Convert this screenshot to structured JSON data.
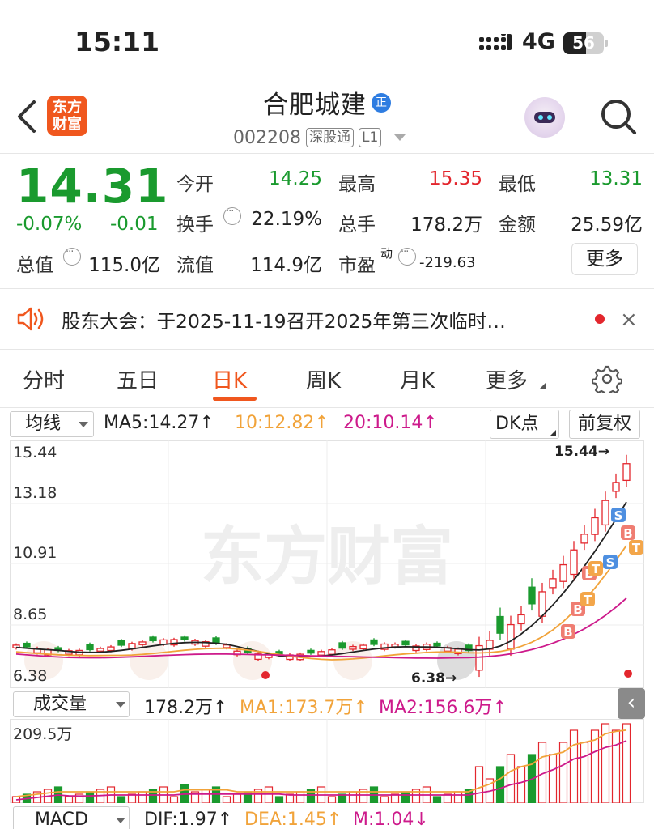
{
  "status_bar": {
    "time": "15:11",
    "network": "4G",
    "battery": "56",
    "battery_level": 0.56
  },
  "header": {
    "stock_name": "合肥城建",
    "badge": "正",
    "stock_code": "002208",
    "tag_connect": "深股通",
    "tag_level": "L1",
    "logo_line1": "东方",
    "logo_line2": "财富"
  },
  "quote": {
    "price": "14.31",
    "change_pct": "-0.07%",
    "change_amt": "-0.01",
    "open_label": "今开",
    "open_value": "14.25",
    "high_label": "最高",
    "high_value": "15.35",
    "low_label": "最低",
    "low_value": "13.31",
    "turnover_label": "换手",
    "turnover_value": "22.19%",
    "volume_label": "总手",
    "volume_value": "178.2万",
    "amount_label": "金额",
    "amount_value": "25.59亿",
    "mktcap_label": "总值",
    "mktcap_value": "115.0亿",
    "float_label": "流值",
    "float_value": "114.9亿",
    "pe_label": "市盈",
    "pe_sup": "动",
    "pe_value": "-219.63",
    "more_label": "更多"
  },
  "notice": {
    "text": "股东大会：于2025-11-19召开2025年第三次临时…",
    "close": "×"
  },
  "tabs": [
    {
      "label": "分时"
    },
    {
      "label": "五日"
    },
    {
      "label": "日K"
    },
    {
      "label": "周K"
    },
    {
      "label": "月K"
    },
    {
      "label": "更多"
    }
  ],
  "kline_toolbar": {
    "indicator": "均线",
    "ma5": "MA5:14.27↑",
    "ma10": "10:12.82↑",
    "ma20": "20:10.14↑",
    "dk": "DK点",
    "adjust": "前复权"
  },
  "volume_toolbar": {
    "indicator": "成交量",
    "vol": "178.2万↑",
    "ma1": "MA1:173.7万↑",
    "ma2": "MA2:156.6万↑"
  },
  "macd_toolbar": {
    "indicator": "MACD",
    "dif": "DIF:1.97↑",
    "dea": "DEA:1.45↑",
    "m": "M:1.04↓"
  },
  "colors": {
    "up": "#e3262d",
    "down": "#1a9a2e",
    "ma5": "#222222",
    "ma10": "#f1a33a",
    "ma20": "#cd1a8b",
    "accent": "#f0571e"
  },
  "chart_data": {
    "type": "candlestick",
    "y_ticks": [
      "15.44",
      "13.18",
      "10.91",
      "8.65",
      "6.38"
    ],
    "ylim": [
      6.38,
      15.44
    ],
    "high_marker": "15.44→",
    "low_marker": "6.38→",
    "watermark": "东方财富",
    "volume_ylabel": "209.5万",
    "volume_ylim": [
      0,
      209.5
    ],
    "signals": [
      "B",
      "B",
      "T",
      "B",
      "T",
      "S",
      "S",
      "B",
      "T"
    ]
  }
}
